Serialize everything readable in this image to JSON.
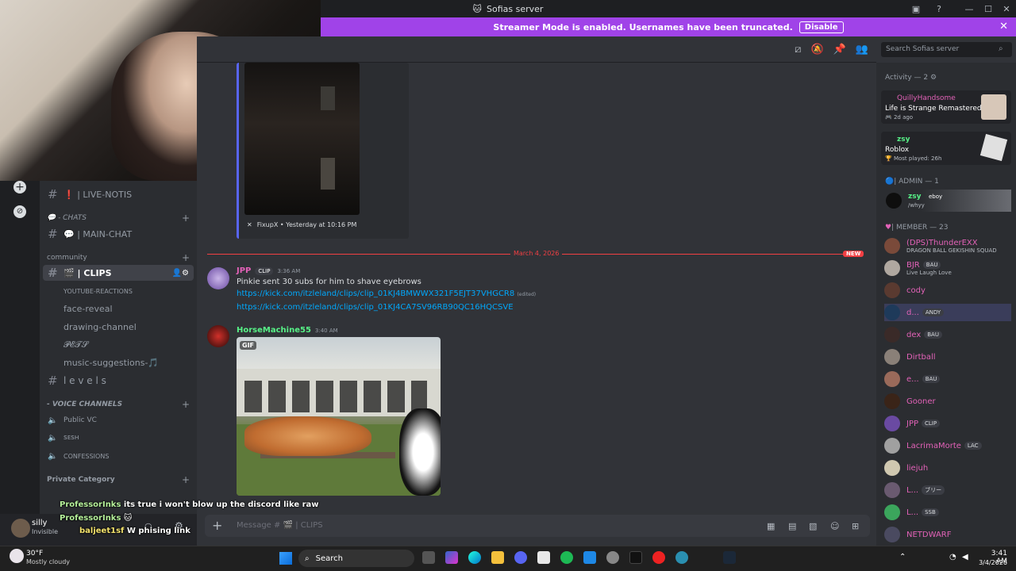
{
  "window": {
    "title": "Sofias server",
    "title_icon": "discord-icon"
  },
  "banner": {
    "text": "Streamer Mode is enabled. Usernames have been truncated.",
    "button": "Disable"
  },
  "search": {
    "placeholder": "Search Sofias server"
  },
  "channels": {
    "live_notis": "❗ | LIVE-NOTIS",
    "chats_cat": "💬 - CHATS",
    "main_chat": "💬 | MAIN-CHAT",
    "community_cat": "community",
    "clips": "🎬 | CLIPS",
    "youtube": "YOUTUBE-REACTIONS",
    "face_reveal": "face-reveal",
    "drawing": "drawing-channel",
    "pets": "𝓟𝓔𝓣𝓢",
    "music": "music-suggestions-🎵",
    "levels": "l e v e l s",
    "voice_cat": "- VOICE CHANNELS",
    "public_vc": "Public VC",
    "sesh": "ꜱᴇꜱʜ",
    "confessions": "CONFESSIONS",
    "private_cat": "Private Category"
  },
  "user": {
    "name": "silly",
    "status": "Invisible"
  },
  "chat": {
    "embed_footer": "FixupX • Yesterday at 10:16 PM",
    "date_divider": "March 4, 2026",
    "new_badge": "NEW",
    "msg1": {
      "author": "JPP",
      "badge": "CLIP",
      "time": "3:36 AM",
      "text": "Pinkie sent 30 subs for him to shave eyebrows",
      "link1": "https://kick.com/itzleland/clips/clip_01KJ4BMWWX321F5EJT37VHGCR8",
      "edited": "(edited)",
      "link2": "https://kick.com/itzleland/clips/clip_01KJ4CA7SV96RB90QC16HQCSVE"
    },
    "msg2": {
      "author": "HorseMachine55",
      "time": "3:40 AM",
      "gif_label": "GIF"
    },
    "composer_placeholder": "Message # 🎬 | CLIPS"
  },
  "overlay_chat": [
    {
      "user": "ProfessorInks",
      "text": "its true i won't blow up the discord like raw"
    },
    {
      "user": "ProfessorInks",
      "text": ""
    },
    {
      "user": "baljeet1sf",
      "text": "W phising link"
    }
  ],
  "members": {
    "activity_header": "Activity — 2",
    "act1": {
      "name": "QuillyHandsome",
      "game": "Life is Strange Remastered",
      "meta": "2d ago"
    },
    "act2": {
      "name": "zsy",
      "game": "Roblox",
      "meta": "Most played: 26h"
    },
    "admin_header": "| ADMIN — 1",
    "admin1": {
      "name": "zsy",
      "badge": "eboy",
      "status": "/whyy"
    },
    "member_header": "| MEMBER — 23",
    "list": [
      {
        "name": "(DPS)ThunderEXX",
        "badge": "",
        "status": "DRAGON BALL GEKISHIN SQUAD",
        "color": "#e362b8"
      },
      {
        "name": "BJR",
        "badge": "BAU",
        "status": "Live Laugh Love",
        "color": "#e362b8"
      },
      {
        "name": "cody",
        "badge": "",
        "status": "",
        "color": "#e362b8"
      },
      {
        "name": "d...",
        "badge": "ANDY",
        "status": "",
        "color": "#e362b8"
      },
      {
        "name": "dex",
        "badge": "BAU",
        "status": "",
        "color": "#e362b8"
      },
      {
        "name": "Dirtball",
        "badge": "",
        "status": "",
        "color": "#e362b8"
      },
      {
        "name": "e...",
        "badge": "BAU",
        "status": "",
        "color": "#e362b8"
      },
      {
        "name": "Gooner",
        "badge": "",
        "status": "",
        "color": "#e362b8"
      },
      {
        "name": "JPP",
        "badge": "CLIP",
        "status": "",
        "color": "#e362b8"
      },
      {
        "name": "LacrimaMorte",
        "badge": "LAC",
        "status": "",
        "color": "#e362b8"
      },
      {
        "name": "liejuh",
        "badge": "",
        "status": "",
        "color": "#e362b8"
      },
      {
        "name": "L...",
        "badge": "ブリー",
        "status": "",
        "color": "#e362b8"
      },
      {
        "name": "L...",
        "badge": "SSB",
        "status": "",
        "color": "#e362b8"
      },
      {
        "name": "NETDWARF",
        "badge": "",
        "status": "",
        "color": "#e362b8"
      }
    ]
  },
  "taskbar": {
    "weather_temp": "30°F",
    "weather_desc": "Mostly cloudy",
    "search": "Search",
    "time": "3:41 AM",
    "date": "3/4/2026"
  },
  "colors": {
    "accent": "#a043e8",
    "link": "#00a8fc",
    "green_name": "#57f287",
    "pink_name": "#e362b8",
    "red_divider": "#f23f43"
  }
}
